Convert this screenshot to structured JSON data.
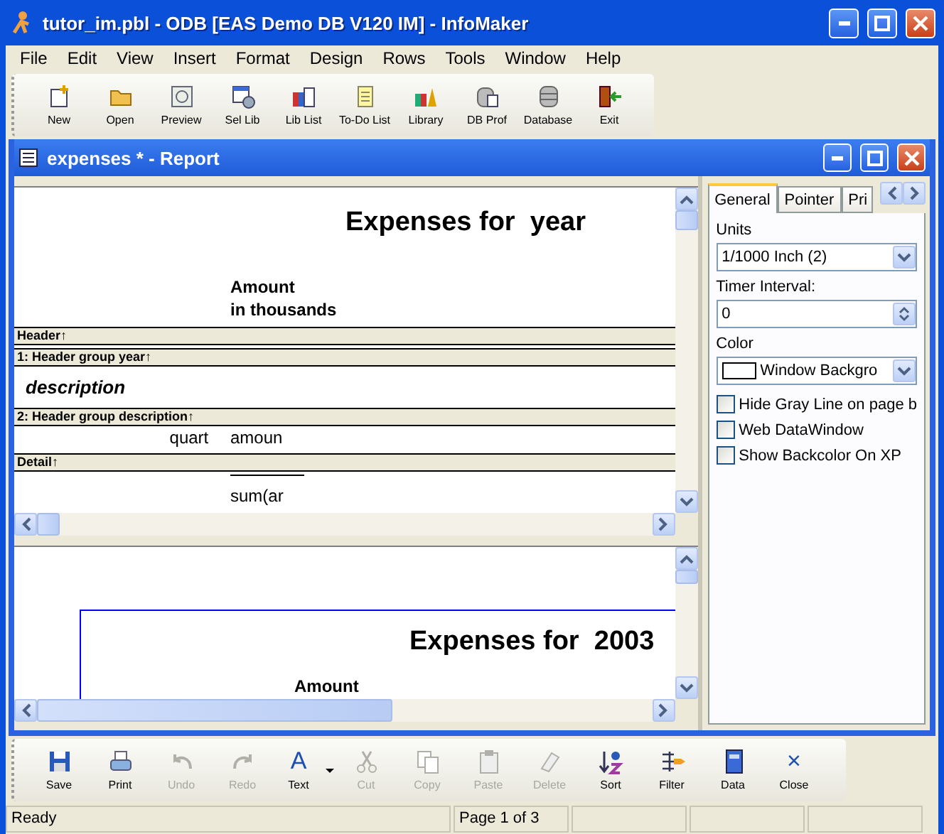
{
  "window": {
    "title": "tutor_im.pbl - ODB [EAS Demo DB V120 IM]  - InfoMaker"
  },
  "menu": [
    "File",
    "Edit",
    "View",
    "Insert",
    "Format",
    "Design",
    "Rows",
    "Tools",
    "Window",
    "Help"
  ],
  "toolbar": [
    {
      "label": "New"
    },
    {
      "label": "Open"
    },
    {
      "label": "Preview"
    },
    {
      "label": "Sel Lib"
    },
    {
      "label": "Lib List"
    },
    {
      "label": "To-Do List"
    },
    {
      "label": "Library"
    },
    {
      "label": "DB Prof"
    },
    {
      "label": "Database"
    },
    {
      "label": "Exit"
    }
  ],
  "document": {
    "title": "expenses * - Report",
    "design": {
      "title": "Expenses for  year",
      "amount_header": "Amount",
      "amount_subheader": "in thousands",
      "bands": [
        {
          "label": "Header↑"
        },
        {
          "label": "1: Header group year↑"
        },
        {
          "label": "2: Header group description↑"
        },
        {
          "label": "Detail↑"
        }
      ],
      "group_field": "description",
      "quarter_field": "quart",
      "amount_field": "amoun",
      "summary_field": "sum(ar"
    },
    "preview": {
      "title": "Expenses for  2003",
      "amount_header": "Amount"
    }
  },
  "properties": {
    "tabs": [
      {
        "label": "General",
        "selected": true
      },
      {
        "label": "Pointer",
        "selected": false
      },
      {
        "label": "Pri",
        "selected": false
      }
    ],
    "units_label": "Units",
    "units_value": "1/1000 Inch (2)",
    "timer_label": "Timer Interval:",
    "timer_value": "0",
    "color_label": "Color",
    "color_value": "Window Backgro",
    "checkboxes": [
      {
        "label": "Hide Gray Line on page b",
        "checked": false
      },
      {
        "label": "Web DataWindow",
        "checked": false
      },
      {
        "label": "Show Backcolor On XP",
        "checked": false
      }
    ]
  },
  "bottom_toolbar": [
    {
      "label": "Save",
      "disabled": false
    },
    {
      "label": "Print",
      "disabled": false
    },
    {
      "label": "Undo",
      "disabled": true
    },
    {
      "label": "Redo",
      "disabled": true
    },
    {
      "label": "Text",
      "disabled": false,
      "glyph": "A"
    },
    {
      "label": "Cut",
      "disabled": true
    },
    {
      "label": "Copy",
      "disabled": true
    },
    {
      "label": "Paste",
      "disabled": true
    },
    {
      "label": "Delete",
      "disabled": true
    },
    {
      "label": "Sort",
      "disabled": false
    },
    {
      "label": "Filter",
      "disabled": false
    },
    {
      "label": "Data",
      "disabled": false
    },
    {
      "label": "Close",
      "disabled": false,
      "glyph": "×"
    }
  ],
  "status_bar": [
    "Ready",
    "Page 1 of 3"
  ]
}
